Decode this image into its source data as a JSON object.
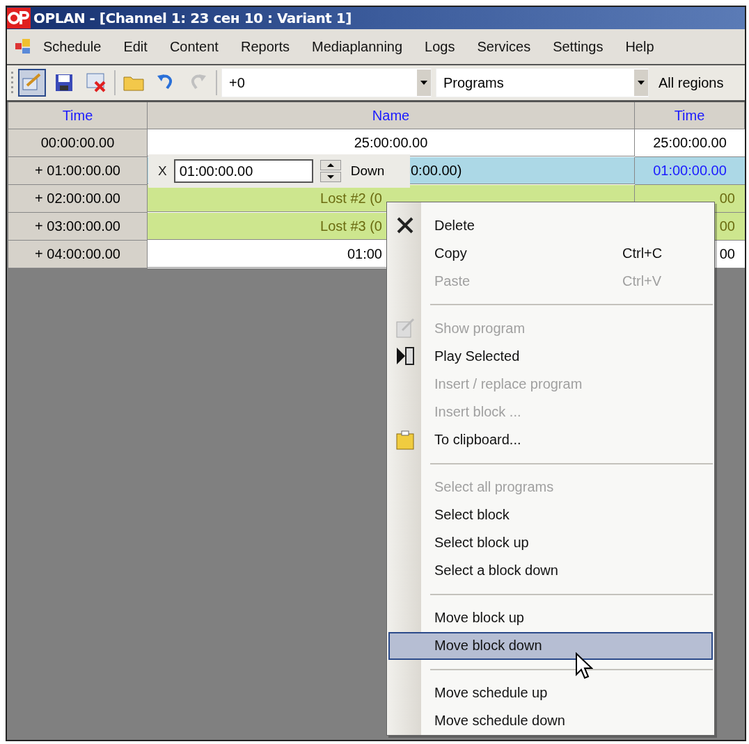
{
  "window": {
    "title": "OPLAN - [Channel 1: 23 сен 10 : Variant 1]"
  },
  "menu_bar": [
    "Schedule",
    "Edit",
    "Content",
    "Reports",
    "Mediaplanning",
    "Logs",
    "Services",
    "Settings",
    "Help"
  ],
  "toolbar": {
    "edit_pressed": true,
    "redo_disabled": true,
    "offset_combo": {
      "value": "+0"
    },
    "type_combo": {
      "value": "Programs"
    },
    "regions": "All regions"
  },
  "table": {
    "columns": [
      "Time",
      "Name",
      "Time"
    ],
    "rows": [
      {
        "kind": "plain",
        "start": "00:00:00.00",
        "name": "25:00:00.00",
        "covered_left": false,
        "covered_right": false,
        "end": "25:00:00.00",
        "end_covered": false
      },
      {
        "kind": "current",
        "start": "+ 01:00:00.00",
        "name": "0:00.00)",
        "covered_left": true,
        "covered_right": false,
        "end": "01:00:00.00",
        "end_covered": false
      },
      {
        "kind": "lost",
        "start": "+ 02:00:00.00",
        "name": "Lost #2 (0",
        "covered_left": false,
        "covered_right": true,
        "end": "00",
        "end_covered": true
      },
      {
        "kind": "lost",
        "start": "+ 03:00:00.00",
        "name": "Lost #3 (0",
        "covered_left": false,
        "covered_right": true,
        "end": "00",
        "end_covered": true
      },
      {
        "kind": "plain",
        "start": "+ 04:00:00.00",
        "name": "01:00",
        "covered_left": false,
        "covered_right": true,
        "end": "00",
        "end_covered": true
      }
    ]
  },
  "shift_editor": {
    "label": "X",
    "value": "01:00:00.00",
    "button": "Down"
  },
  "context_menu": {
    "items": [
      {
        "kind": "item",
        "label": "Delete",
        "disabled": false,
        "selected": false
      },
      {
        "kind": "item",
        "label": "Copy",
        "shortcut": "Ctrl+C",
        "disabled": false,
        "selected": false
      },
      {
        "kind": "item",
        "label": "Paste",
        "shortcut": "Ctrl+V",
        "disabled": true,
        "selected": false
      },
      {
        "kind": "separator"
      },
      {
        "kind": "item",
        "label": "Show program",
        "disabled": true,
        "selected": false
      },
      {
        "kind": "item",
        "label": "Play Selected",
        "disabled": false,
        "selected": false
      },
      {
        "kind": "item",
        "label": "Insert / replace program",
        "disabled": true,
        "selected": false
      },
      {
        "kind": "item",
        "label": "Insert block ...",
        "disabled": true,
        "selected": false
      },
      {
        "kind": "item",
        "label": "To clipboard...",
        "disabled": false,
        "selected": false
      },
      {
        "kind": "separator"
      },
      {
        "kind": "item",
        "label": "Select all programs",
        "disabled": true,
        "selected": false
      },
      {
        "kind": "item",
        "label": "Select block",
        "disabled": false,
        "selected": false
      },
      {
        "kind": "item",
        "label": "Select block up",
        "disabled": false,
        "selected": false
      },
      {
        "kind": "item",
        "label": "Select a block down",
        "disabled": false,
        "selected": false
      },
      {
        "kind": "separator"
      },
      {
        "kind": "item",
        "label": "Move block up",
        "disabled": false,
        "selected": false
      },
      {
        "kind": "item",
        "label": "Move block down",
        "disabled": false,
        "selected": true
      },
      {
        "kind": "separator"
      },
      {
        "kind": "item",
        "label": "Move schedule up",
        "disabled": false,
        "selected": false
      },
      {
        "kind": "item",
        "label": "Move schedule down",
        "disabled": false,
        "selected": false
      }
    ]
  }
}
